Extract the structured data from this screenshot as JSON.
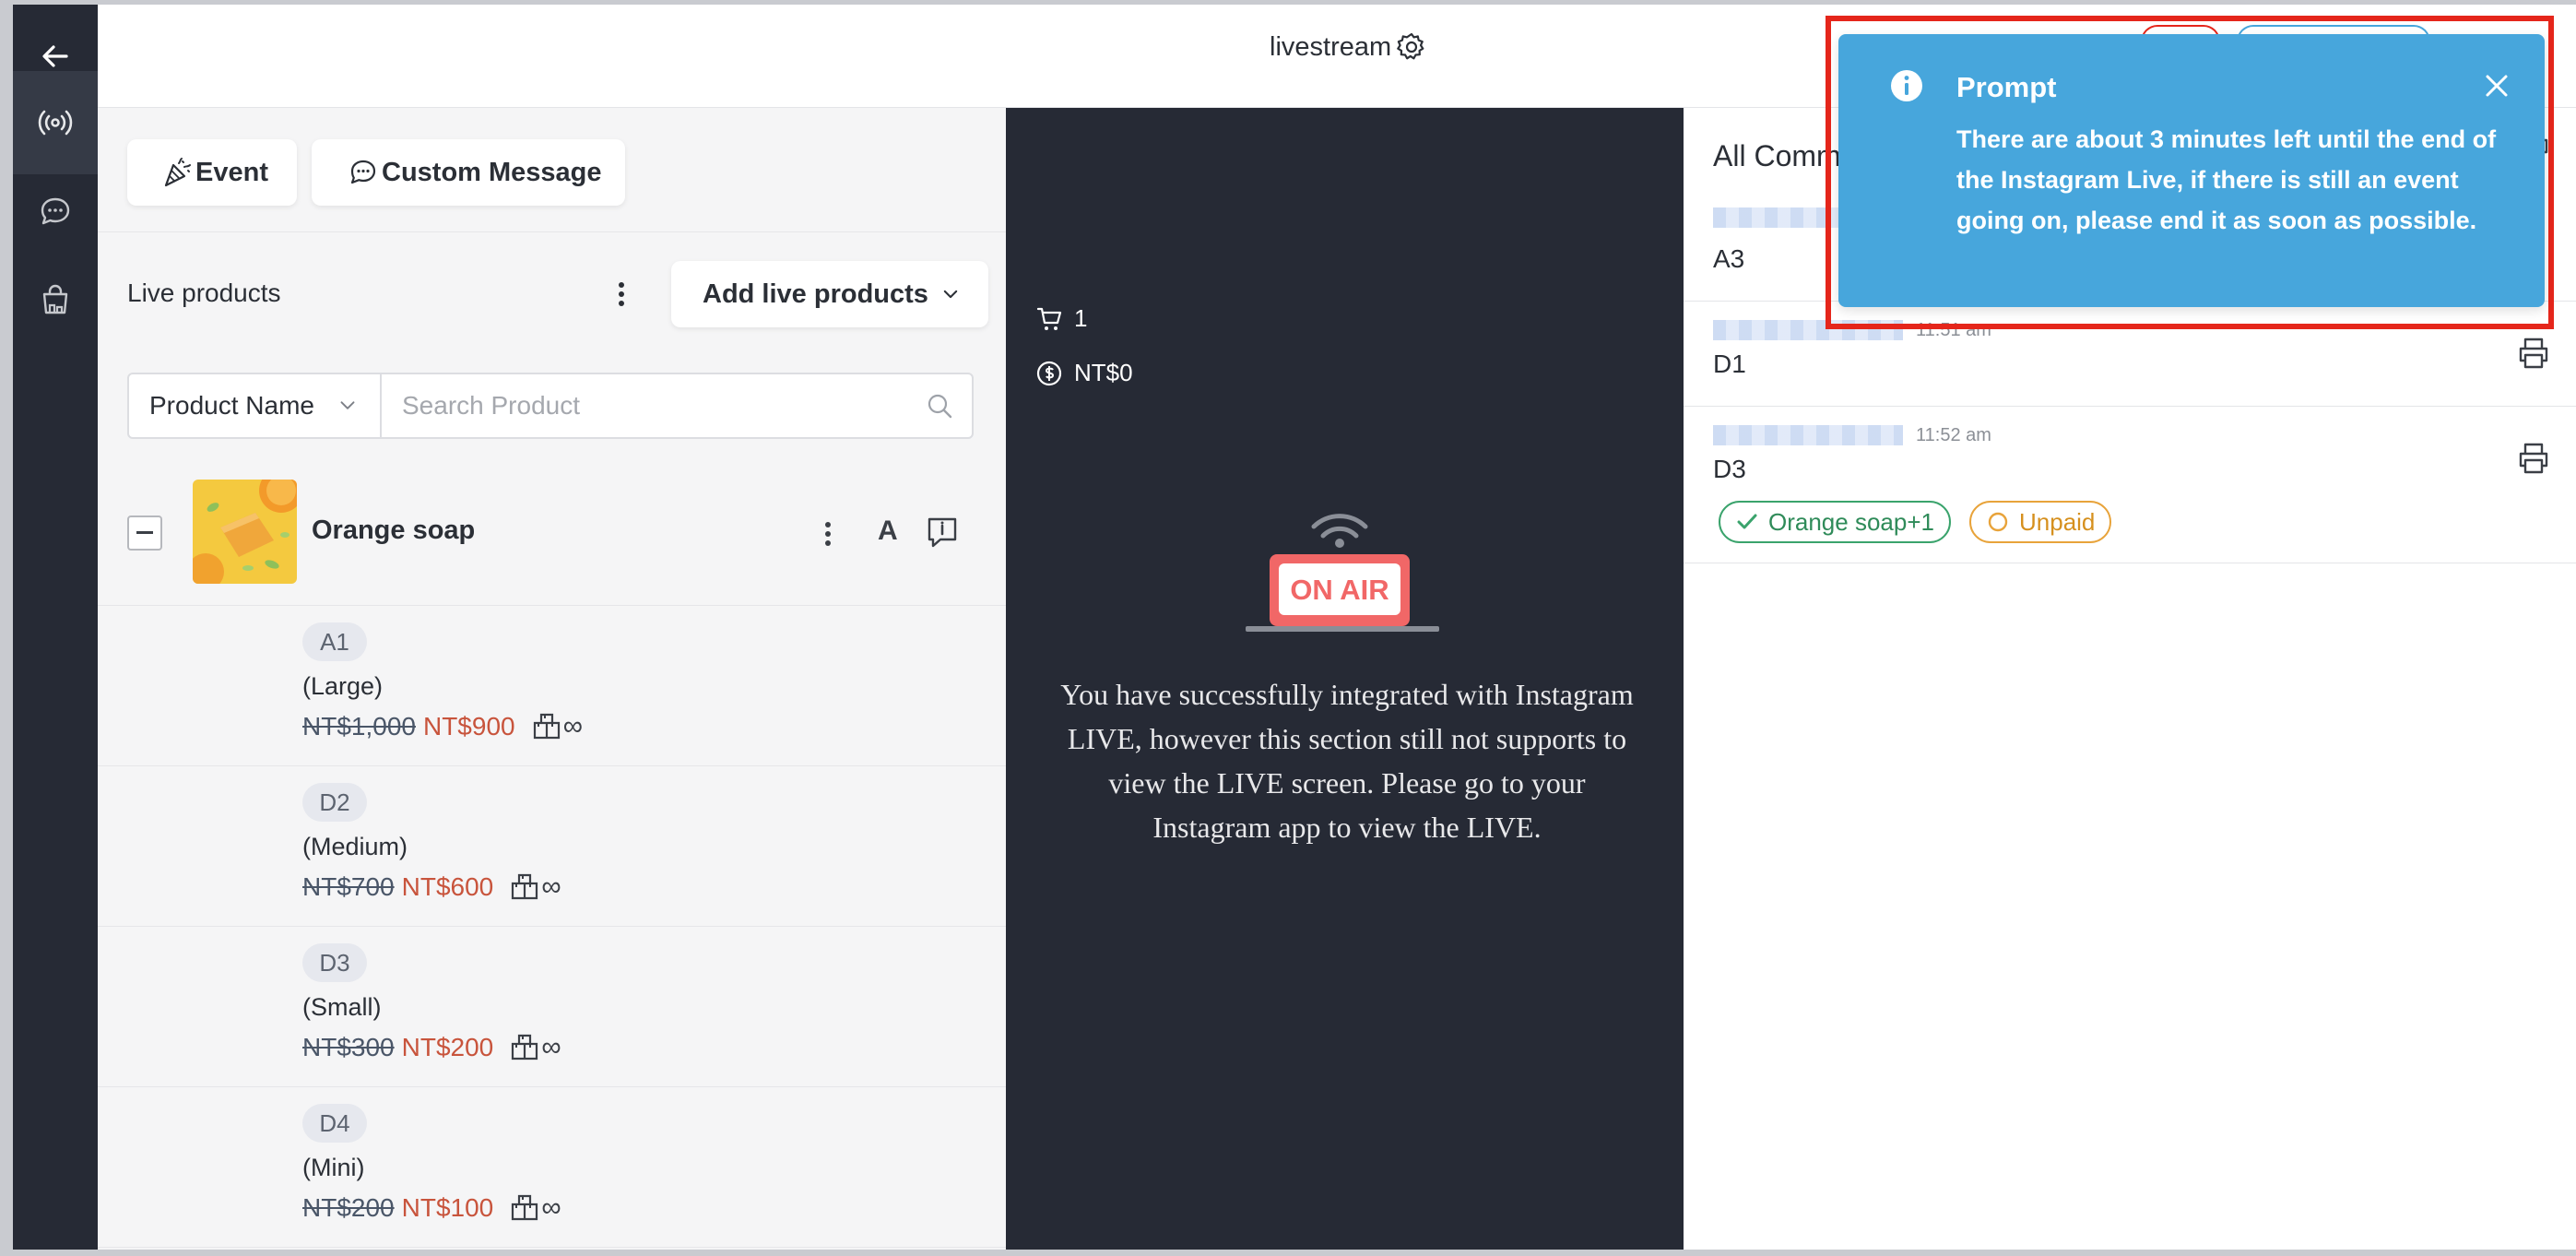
{
  "header": {
    "title": "livestream"
  },
  "left_panel": {
    "event_button_label": "Event",
    "custom_message_button_label": "Custom Message",
    "live_products_label": "Live products",
    "add_live_products_label": "Add live products",
    "search": {
      "filter_selected": "Product Name",
      "placeholder": "Search Product"
    },
    "product": {
      "name": "Orange soap",
      "letter_badge": "A",
      "variants": [
        {
          "code": "A1",
          "size": "(Large)",
          "old_price": "NT$1,000",
          "new_price": "NT$900",
          "stock": "∞"
        },
        {
          "code": "D2",
          "size": "(Medium)",
          "old_price": "NT$700",
          "new_price": "NT$600",
          "stock": "∞"
        },
        {
          "code": "D3",
          "size": "(Small)",
          "old_price": "NT$300",
          "new_price": "NT$200",
          "stock": "∞"
        },
        {
          "code": "D4",
          "size": "(Mini)",
          "old_price": "NT$200",
          "new_price": "NT$100",
          "stock": "∞"
        }
      ]
    }
  },
  "live_panel": {
    "cart_count": "1",
    "revenue": "NT$0",
    "on_air_label": "ON AIR",
    "message": "You have successfully integrated with Instagram LIVE, however this section still not supports to view the LIVE screen. Please go to your Instagram app to view the LIVE."
  },
  "comments_panel": {
    "title": "All Comm",
    "comments": [
      {
        "time": "",
        "text": "A3"
      },
      {
        "time": "11:51 am",
        "text": "D1"
      },
      {
        "time": "11:52 am",
        "text": "D3",
        "tags": {
          "product": "Orange soap+1",
          "status": "Unpaid"
        }
      }
    ]
  },
  "toast": {
    "title": "Prompt",
    "message": "There are about 3 minutes left until the end of the Instagram Live, if there is still an event going on, please end it as soon as possible."
  },
  "colors": {
    "rail_bg": "#262a35",
    "live_bg": "#262a35",
    "toast_bg": "#47a6dc",
    "highlight_border": "#e5261b",
    "price_new": "#c8543c",
    "tag_green": "#3aa36c",
    "tag_orange": "#e8a33a",
    "on_air_red": "#f16767"
  }
}
